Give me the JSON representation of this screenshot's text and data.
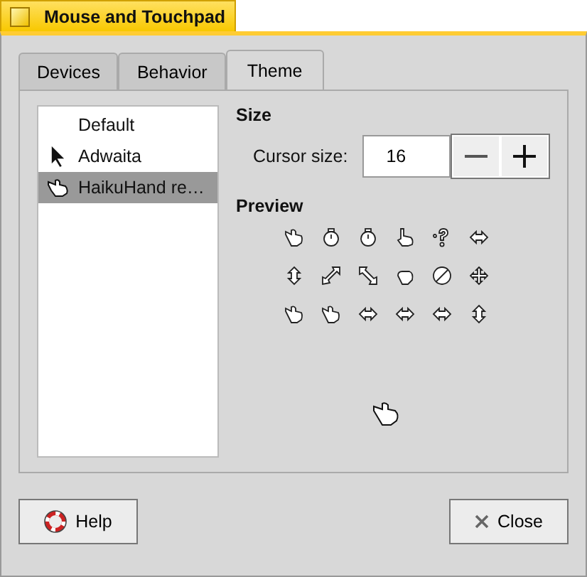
{
  "window": {
    "title": "Mouse and Touchpad"
  },
  "tabs": [
    {
      "label": "Devices",
      "selected": false
    },
    {
      "label": "Behavior",
      "selected": false
    },
    {
      "label": "Theme",
      "selected": true
    }
  ],
  "themes": [
    {
      "label": "Default",
      "selected": false
    },
    {
      "label": "Adwaita",
      "selected": false
    },
    {
      "label": "HaikuHand re…",
      "selected": true
    }
  ],
  "size": {
    "heading": "Size",
    "label": "Cursor size:",
    "value": "16"
  },
  "preview": {
    "heading": "Preview"
  },
  "buttons": {
    "help": "Help",
    "close": "Close"
  }
}
